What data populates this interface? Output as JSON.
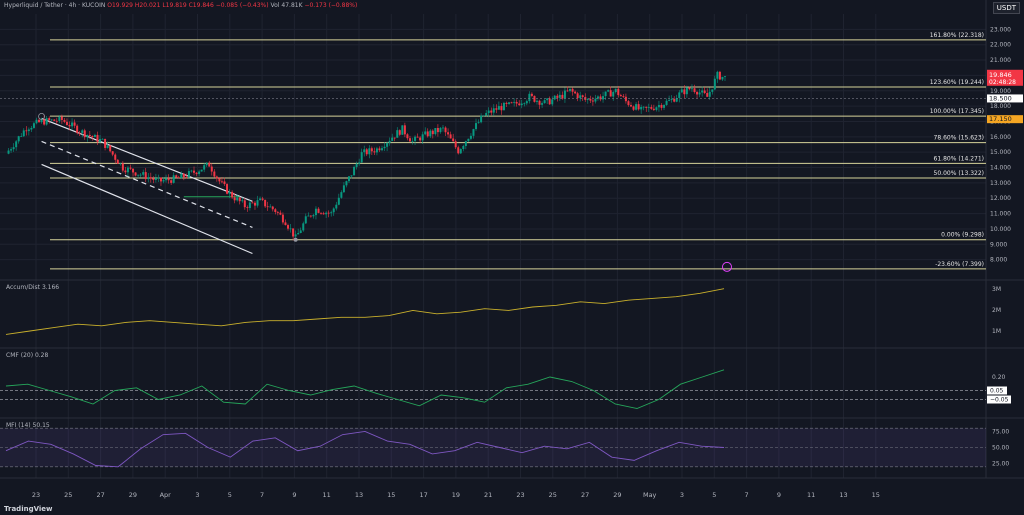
{
  "header": {
    "symbol": "Hyperliquid / Tether · 4h · KUCOIN",
    "o": "O19.929",
    "h": "H20.021",
    "l": "L19.819",
    "c": "C19.846",
    "change": "−0.085 (−0.43%)",
    "vol": "Vol 47.81K",
    "vol_change": "−0.173 (−0.88%)",
    "currency": "USDT"
  },
  "brand": "TradingView",
  "colors": {
    "up": "#089981",
    "down": "#f23645",
    "fib": "#d6d39a",
    "channel": "#e0e3eb",
    "accum": "#c9b02c",
    "cmf": "#26a65b",
    "mfi": "#7e57c2"
  },
  "chart_data": [
    {
      "type": "candlestick",
      "title": "Hyperliquid / Tether",
      "timeframe": "4h",
      "exchange": "KUCOIN",
      "x_ticks": [
        "23",
        "25",
        "27",
        "29",
        "Apr",
        "3",
        "5",
        "7",
        "9",
        "11",
        "13",
        "15",
        "17",
        "19",
        "21",
        "23",
        "25",
        "27",
        "29",
        "May",
        "3",
        "5",
        "7",
        "9",
        "11",
        "13",
        "15"
      ],
      "y_ticks": [
        8.0,
        9.0,
        10.0,
        11.0,
        12.0,
        13.0,
        14.0,
        15.0,
        16.0,
        17.0,
        18.0,
        19.0,
        20.0,
        21.0,
        22.0,
        23.0
      ],
      "ylim": [
        7.0,
        24.0
      ],
      "price_path": [
        [
          0,
          14.9
        ],
        [
          8,
          16.6
        ],
        [
          14,
          17.0
        ],
        [
          22,
          17.1
        ],
        [
          30,
          16.3
        ],
        [
          38,
          15.7
        ],
        [
          46,
          14.0
        ],
        [
          54,
          13.5
        ],
        [
          60,
          13.1
        ],
        [
          68,
          13.3
        ],
        [
          74,
          13.7
        ],
        [
          80,
          14.2
        ],
        [
          84,
          13.1
        ],
        [
          88,
          12.3
        ],
        [
          94,
          11.5
        ],
        [
          100,
          11.8
        ],
        [
          106,
          11.2
        ],
        [
          110,
          10.5
        ],
        [
          114,
          9.4
        ],
        [
          118,
          10.6
        ],
        [
          122,
          11.3
        ],
        [
          128,
          11.0
        ],
        [
          132,
          12.4
        ],
        [
          136,
          13.6
        ],
        [
          140,
          14.9
        ],
        [
          146,
          15.2
        ],
        [
          152,
          16.0
        ],
        [
          156,
          16.5
        ],
        [
          160,
          15.7
        ],
        [
          166,
          16.2
        ],
        [
          172,
          16.5
        ],
        [
          178,
          15.1
        ],
        [
          184,
          16.5
        ],
        [
          188,
          17.4
        ],
        [
          194,
          17.9
        ],
        [
          200,
          18.1
        ],
        [
          206,
          18.6
        ],
        [
          212,
          18.2
        ],
        [
          218,
          18.6
        ],
        [
          222,
          19.0
        ],
        [
          228,
          18.4
        ],
        [
          234,
          18.6
        ],
        [
          240,
          19.0
        ],
        [
          244,
          18.3
        ],
        [
          250,
          17.7
        ],
        [
          256,
          18.0
        ],
        [
          262,
          18.4
        ],
        [
          266,
          18.9
        ],
        [
          270,
          19.2
        ],
        [
          276,
          18.6
        ],
        [
          280,
          20.0
        ],
        [
          283,
          19.85
        ]
      ],
      "last_price": "19.846",
      "countdown": "02:48:28",
      "price_line": "18.500",
      "fib_price_tag": "17.150",
      "fib_levels": [
        {
          "label": "161.80% (22.318)",
          "value": 22.318
        },
        {
          "label": "123.60% (19.244)",
          "value": 19.244
        },
        {
          "label": "100.00% (17.345)",
          "value": 17.345
        },
        {
          "label": "78.60% (15.623)",
          "value": 15.623
        },
        {
          "label": "61.80% (14.271)",
          "value": 14.271
        },
        {
          "label": "50.00% (13.322)",
          "value": 13.322
        },
        {
          "label": "0.00% (9.298)",
          "value": 9.298
        },
        {
          "label": "-23.60% (7.399)",
          "value": 7.399
        }
      ]
    },
    {
      "type": "line",
      "name": "Accum/Dist",
      "legend": "Accum/Dist  3.166",
      "y_ticks": [
        "3M",
        "2M",
        "1M"
      ],
      "values": [
        0.5,
        0.7,
        0.9,
        1.1,
        1.0,
        1.2,
        1.3,
        1.2,
        1.1,
        1.0,
        1.2,
        1.3,
        1.3,
        1.4,
        1.5,
        1.5,
        1.6,
        1.9,
        1.7,
        1.8,
        2.0,
        1.9,
        2.1,
        2.2,
        2.4,
        2.3,
        2.5,
        2.6,
        2.7,
        2.9,
        3.17
      ]
    },
    {
      "type": "line",
      "name": "CMF (20)",
      "legend": "CMF (20)  0.28",
      "y_ticks": [
        "0.20",
        "0.05",
        "−0.05"
      ],
      "values": [
        0.1,
        0.12,
        0.05,
        -0.02,
        -0.1,
        0.05,
        0.08,
        -0.05,
        0.0,
        0.1,
        -0.08,
        -0.1,
        0.12,
        0.05,
        0.0,
        0.06,
        0.1,
        0.02,
        -0.05,
        -0.12,
        0.0,
        -0.03,
        -0.08,
        0.08,
        0.12,
        0.2,
        0.15,
        0.05,
        -0.1,
        -0.15,
        -0.05,
        0.12,
        0.2,
        0.28
      ]
    },
    {
      "type": "line",
      "name": "MFI (14)",
      "legend": "MFI (14)  50.15",
      "y_ticks": [
        "75.00",
        "50.00",
        "25.00"
      ],
      "values": [
        45,
        60,
        55,
        40,
        22,
        20,
        48,
        70,
        72,
        50,
        35,
        60,
        65,
        45,
        52,
        70,
        75,
        60,
        55,
        40,
        45,
        58,
        50,
        42,
        52,
        48,
        58,
        35,
        30,
        45,
        58,
        52,
        50
      ]
    }
  ]
}
